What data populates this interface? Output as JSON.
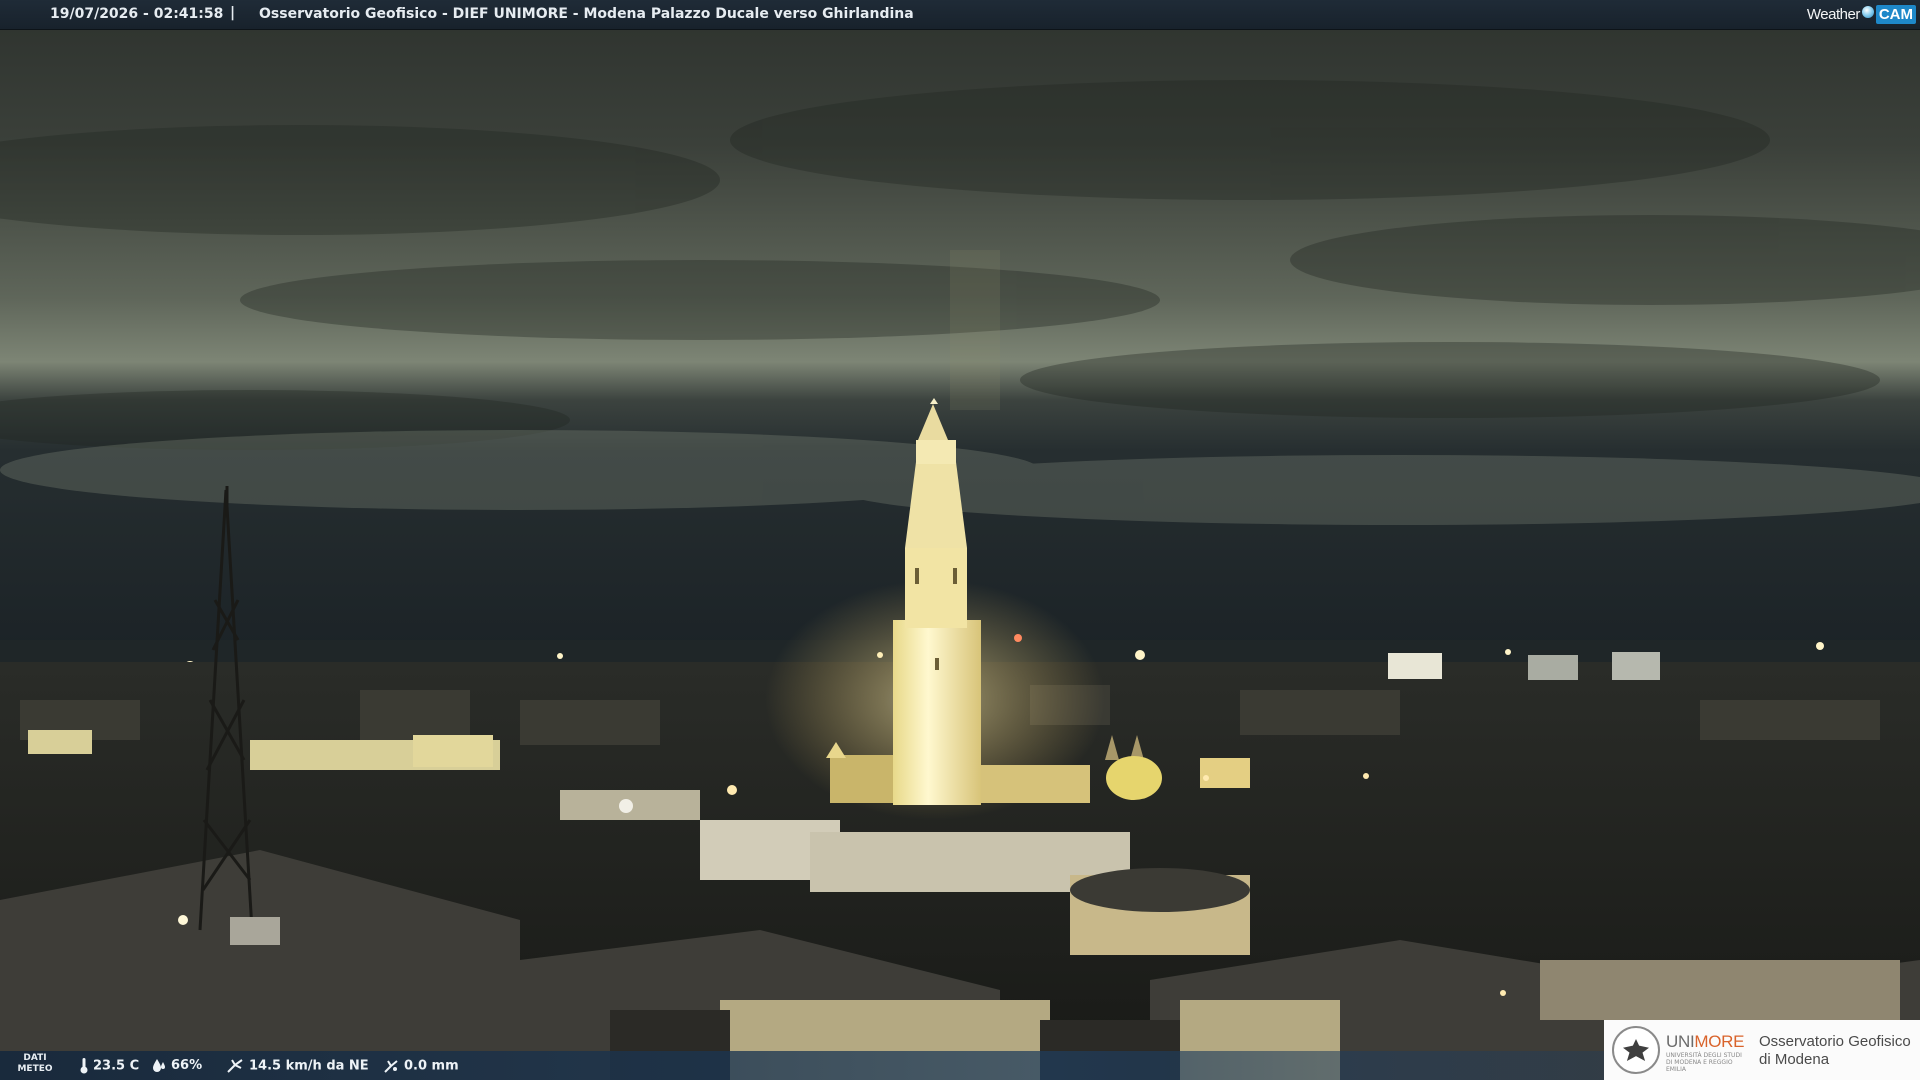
{
  "top_bar": {
    "timestamp": "19/07/2026 - 02:41:58",
    "separator": "|",
    "title": "Osservatorio Geofisico - DIEF UNIMORE - Modena Palazzo Ducale verso Ghirlandina"
  },
  "brand": {
    "word": "Weather",
    "cam": "CAM"
  },
  "bottom_bar": {
    "dati_meteo_line1": "DATI",
    "dati_meteo_line2": "METEO",
    "temperature": "23.5 C",
    "humidity": "66%",
    "wind": "14.5 km/h da NE",
    "rain": "0.0 mm",
    "icons": [
      "thermometer-icon",
      "humidity-drop-icon",
      "wind-icon",
      "rain-gauge-icon"
    ]
  },
  "logo": {
    "uni_part1": "UNI",
    "uni_part2": "MORE",
    "uni_subtitle": "UNIVERSITÀ DEGLI STUDI DI MODENA E REGGIO EMILIA",
    "observatory_line1": "Osservatorio Geofisico",
    "observatory_line2": "di Modena"
  },
  "colors": {
    "top_bar_bg": "#1f2b37",
    "text": "#e6ecf1",
    "cam_badge": "#1e88c9",
    "unimore_orange": "#d9632b",
    "sky_glow": "#7a8272",
    "tower_light": "#fff3b8"
  }
}
